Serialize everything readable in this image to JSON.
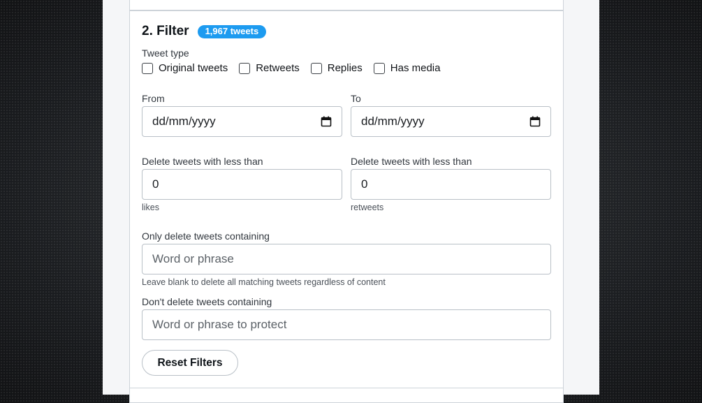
{
  "section": {
    "title": "2. Filter",
    "badge": "1,967 tweets"
  },
  "tweet_type": {
    "label": "Tweet type",
    "options": [
      {
        "label": "Original tweets",
        "checked": false
      },
      {
        "label": "Retweets",
        "checked": false
      },
      {
        "label": "Replies",
        "checked": false
      },
      {
        "label": "Has media",
        "checked": false
      }
    ]
  },
  "date_range": {
    "from_label": "From",
    "from_value": "dd/mm/yyyy",
    "to_label": "To",
    "to_value": "dd/mm/yyyy"
  },
  "thresholds": {
    "likes_label": "Delete tweets with less than",
    "likes_value": "0",
    "likes_unit": "likes",
    "retweets_label": "Delete tweets with less than",
    "retweets_value": "0",
    "retweets_unit": "retweets"
  },
  "include_keywords": {
    "label": "Only delete tweets containing",
    "placeholder": "Word or phrase",
    "hint": "Leave blank to delete all matching tweets regardless of content"
  },
  "exclude_keywords": {
    "label": "Don't delete tweets containing",
    "placeholder": "Word or phrase to protect"
  },
  "actions": {
    "reset_label": "Reset Filters"
  },
  "icons": {
    "calendar": "calendar-icon"
  },
  "colors": {
    "accent": "#1d9bf0"
  }
}
